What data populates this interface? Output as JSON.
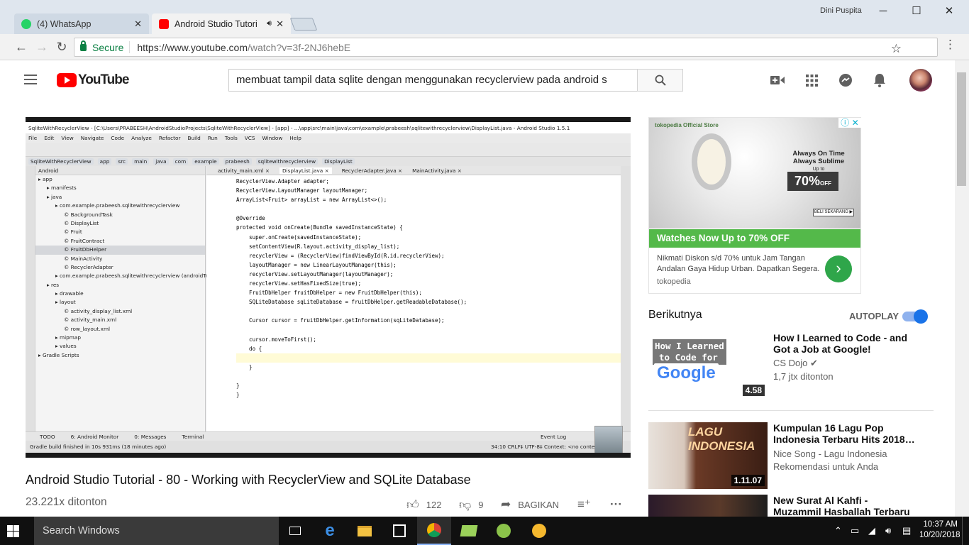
{
  "browser": {
    "tabs": [
      {
        "title": "(4) WhatsApp",
        "close": "✕"
      },
      {
        "title": "Android Studio Tutori",
        "close": "✕"
      }
    ],
    "user": "Dini Puspita",
    "secure_label": "Secure",
    "url_main": "https://www.youtube.com",
    "url_path": "/watch?v=3f-2NJ6hebE"
  },
  "youtube": {
    "logo_text": "YouTube",
    "search_value": "membuat tampil data sqlite dengan menggunakan recyclerview  pada android s"
  },
  "ide": {
    "title": "SqliteWithRecyclerView - [C:\\Users\\PRABEESH\\AndroidStudioProjects\\SqliteWithRecyclerView] - [app] - ...\\app\\src\\main\\java\\com\\example\\prabeesh\\sqlitewithrecyclerview\\DisplayList.java - Android Studio 1.5.1",
    "menu": [
      "File",
      "Edit",
      "View",
      "Navigate",
      "Code",
      "Analyze",
      "Refactor",
      "Build",
      "Run",
      "Tools",
      "VCS",
      "Window",
      "Help"
    ],
    "crumbs": [
      "SqliteWithRecyclerView",
      "app",
      "src",
      "main",
      "java",
      "com",
      "example",
      "prabeesh",
      "sqlitewithrecyclerview",
      "DisplayList"
    ],
    "tree_header": "Android",
    "tree": [
      {
        "label": "app",
        "indent": 0
      },
      {
        "label": "manifests",
        "indent": 1
      },
      {
        "label": "java",
        "indent": 1
      },
      {
        "label": "com.example.prabeesh.sqlitewithrecyclerview",
        "indent": 2
      },
      {
        "label": "BackgroundTask",
        "indent": 3
      },
      {
        "label": "DisplayList",
        "indent": 3
      },
      {
        "label": "Fruit",
        "indent": 3
      },
      {
        "label": "FruitContract",
        "indent": 3
      },
      {
        "label": "FruitDbHelper",
        "indent": 3,
        "selected": true
      },
      {
        "label": "MainActivity",
        "indent": 3
      },
      {
        "label": "RecyclerAdapter",
        "indent": 3
      },
      {
        "label": "com.example.prabeesh.sqlitewithrecyclerview (androidTe",
        "indent": 2
      },
      {
        "label": "res",
        "indent": 1
      },
      {
        "label": "drawable",
        "indent": 2
      },
      {
        "label": "layout",
        "indent": 2
      },
      {
        "label": "activity_display_list.xml",
        "indent": 3
      },
      {
        "label": "activity_main.xml",
        "indent": 3
      },
      {
        "label": "row_layout.xml",
        "indent": 3
      },
      {
        "label": "mipmap",
        "indent": 2
      },
      {
        "label": "values",
        "indent": 2
      },
      {
        "label": "Gradle Scripts",
        "indent": 0
      }
    ],
    "editor_tabs": [
      "activity_main.xml",
      "DisplayList.java",
      "RecyclerAdapter.java",
      "MainActivity.java"
    ],
    "code": [
      "RecyclerView.Adapter adapter;",
      "RecyclerView.LayoutManager layoutManager;",
      "ArrayList<Fruit> arrayList = new ArrayList<>();",
      "",
      "@Override",
      "protected void onCreate(Bundle savedInstanceState) {",
      "    super.onCreate(savedInstanceState);",
      "    setContentView(R.layout.activity_display_list);",
      "    recyclerView = (RecyclerView)findViewById(R.id.recyclerView);",
      "    layoutManager = new LinearLayoutManager(this);",
      "    recyclerView.setLayoutManager(layoutManager);",
      "    recyclerView.setHasFixedSize(true);",
      "    FruitDbHelper fruitDbHelper = new FruitDbHelper(this);",
      "    SQLiteDatabase sqLiteDatabase = fruitDbHelper.getReadableDatabase();",
      "",
      "    Cursor cursor = fruitDbHelper.getInformation(sqLiteDatabase);",
      "",
      "    cursor.moveToFirst();",
      "    do {",
      "",
      "    }",
      "",
      "}",
      "}"
    ],
    "bottom_tabs": [
      "TODO",
      "6: Android Monitor",
      "0: Messages",
      "Terminal"
    ],
    "event_log": "Event Log",
    "status_left": "Gradle build finished in 10s 931ms (18 minutes ago)",
    "status_right": "34:10   CRLF‡   UTF-8‡   Context: <no context>"
  },
  "video": {
    "title": "Android Studio Tutorial - 80 - Working with RecyclerView and SQLite Database",
    "views": "23.221x ditonton",
    "likes": "122",
    "dislikes": "9",
    "share": "BAGIKAN"
  },
  "ad": {
    "brand": "tokopedia Official Store",
    "banner_line1": "Always On Time",
    "banner_line2": "Always Sublime",
    "banner_upto": "Up to",
    "banner_pct": "70%",
    "banner_off": "OFF",
    "banner_cta": "BELI SEKARANG ▶",
    "headline": "Watches Now Up to 70% OFF",
    "description": "Nikmati Diskon s/d 70% untuk Jam Tangan Andalan Gaya Hidup Urban. Dapatkan Segera.",
    "source": "tokopedia"
  },
  "sidebar": {
    "up_next": "Berikutnya",
    "autoplay": "AUTOPLAY",
    "recs": [
      {
        "title": "How I Learned to Code - and Got a Job at Google!",
        "channel": "CS Dojo ✔",
        "views": "1,7 jtx ditonton",
        "duration": "4.58",
        "thumb_text_1": "How I Learned",
        "thumb_text_2": "to Code for",
        "thumb_text_3": "Google"
      },
      {
        "title": "Kumpulan 16 Lagu Pop Indonesia Terbaru Hits 2018…",
        "channel": "Nice Song - Lagu Indonesia",
        "views": "Rekomendasi untuk Anda",
        "duration": "1.11.07",
        "thumb_text_1": "LAGU INDONESIA"
      },
      {
        "title": "New Surat Al Kahfi - Muzammil Hasballah Terbaru",
        "channel": "",
        "views": "",
        "duration": ""
      }
    ]
  },
  "taskbar": {
    "search": "Search Windows",
    "time": "10:37 AM",
    "date": "10/20/2018"
  }
}
